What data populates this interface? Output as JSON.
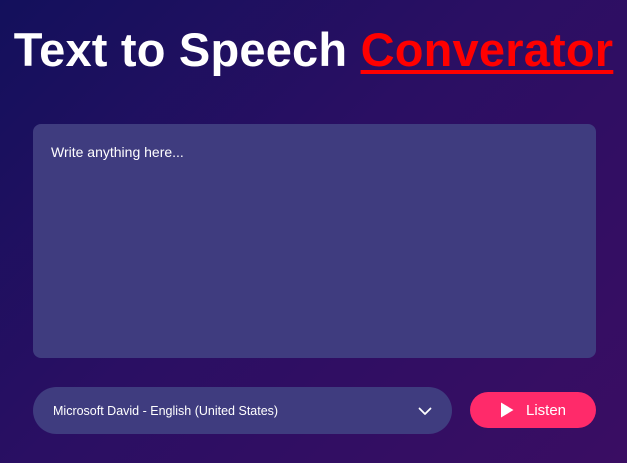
{
  "header": {
    "title_main": "Text to Speech ",
    "title_accent": "Converator"
  },
  "editor": {
    "placeholder": "Write anything here...",
    "value": ""
  },
  "voice_select": {
    "selected": "Microsoft David - English (United States)",
    "icon": "chevron-down-icon"
  },
  "listen_button": {
    "label": "Listen",
    "icon": "play-icon"
  },
  "colors": {
    "background_start": "#13105c",
    "background_end": "#3a0d63",
    "panel": "#3f3c7f",
    "accent_title": "#ff0000",
    "button": "#ff2a6a",
    "text": "#ffffff"
  }
}
